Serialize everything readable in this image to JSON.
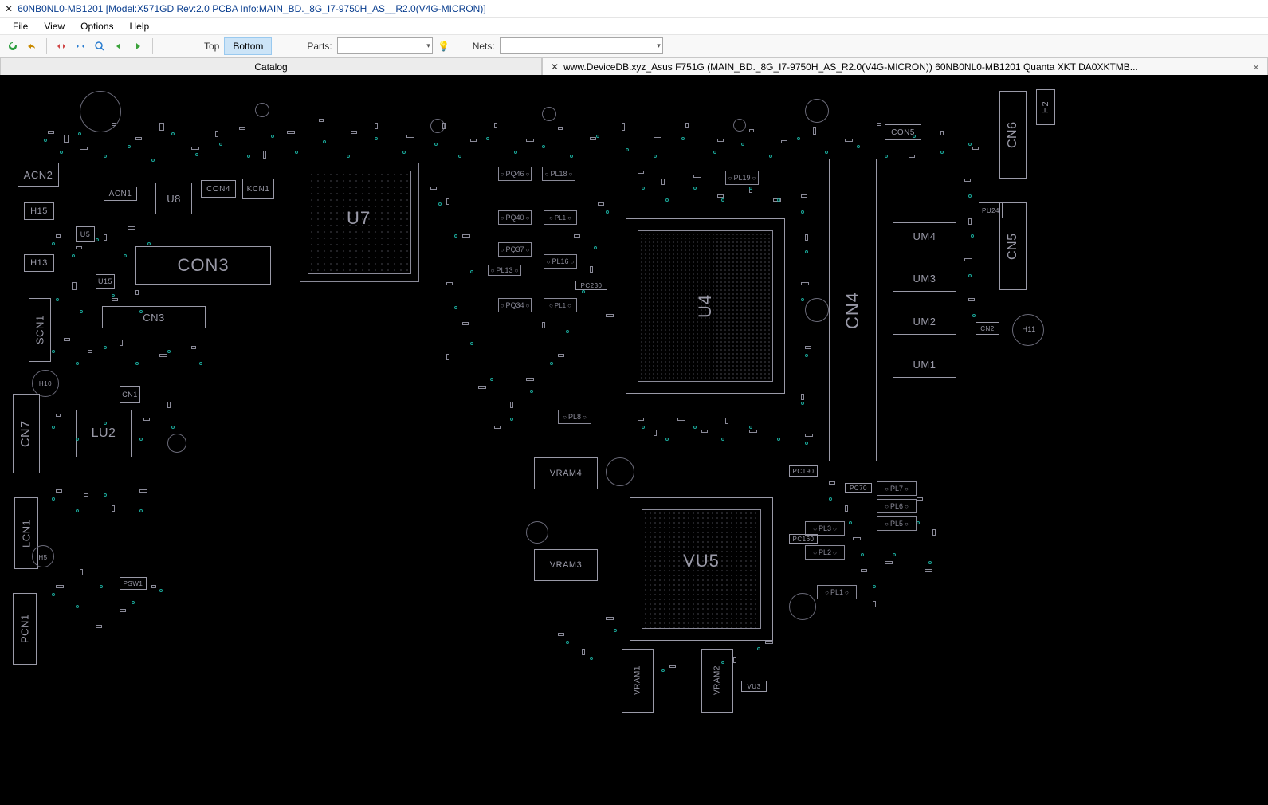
{
  "title": "60NB0NL0-MB1201 [Model:X571GD Rev:2.0 PCBA Info:MAIN_BD._8G_I7-9750H_AS__R2.0(V4G-MICRON)]",
  "menu": {
    "file": "File",
    "view": "View",
    "options": "Options",
    "help": "Help"
  },
  "toolbar": {
    "layer_top": "Top",
    "layer_bottom": "Bottom",
    "parts_label": "Parts:",
    "nets_label": "Nets:",
    "parts_value": "",
    "nets_value": ""
  },
  "tabs": {
    "catalog": "Catalog",
    "doc": "www.DeviceDB.xyz_Asus F751G (MAIN_BD._8G_I7-9750H_AS_R2.0(V4G-MICRON)) 60NB0NL0-MB1201 Quanta XKT DA0XKTMB..."
  },
  "pcb": {
    "ACN2": "ACN2",
    "ACN1": "ACN1",
    "H15": "H15",
    "H13": "H13",
    "U8": "U8",
    "U5": "U5",
    "CON4": "CON4",
    "KCN1": "KCN1",
    "CON3": "CON3",
    "CN3": "CN3",
    "SCN1": "SCN1",
    "CN7": "CN7",
    "LU2": "LU2",
    "LCN1": "LCN1",
    "H5": "H5",
    "PCN1": "PCN1",
    "CN1": "CN1",
    "PSW1": "PSW1",
    "U7": "U7",
    "U4": "U4",
    "VU5": "VU5",
    "VRAM1": "VRAM1",
    "VRAM2": "VRAM2",
    "VRAM3": "VRAM3",
    "VRAM4": "VRAM4",
    "VU3": "VU3",
    "CN4": "CN4",
    "UM1": "UM1",
    "UM2": "UM2",
    "UM3": "UM3",
    "UM4": "UM4",
    "CN6": "CN6",
    "CN5": "CN5",
    "CN2": "CN2",
    "H11": "H11",
    "H2": "H2",
    "CON5": "CON5",
    "PL1": "PL1",
    "PL2": "PL2",
    "PL3": "PL3",
    "PL5": "PL5",
    "PL6": "PL6",
    "PL7": "PL7",
    "PL8": "PL8",
    "PL13": "PL13",
    "PL16": "PL16",
    "PL18": "PL18",
    "PL19": "PL19",
    "PQ34": "PQ34",
    "PQ37": "PQ37",
    "PQ40": "PQ40",
    "PQ46": "PQ46",
    "PC190": "PC190",
    "PC230": "PC230",
    "PC160": "PC160",
    "PC70": "PC70",
    "U15": "U15",
    "H10": "H10",
    "PU24": "PU24"
  }
}
